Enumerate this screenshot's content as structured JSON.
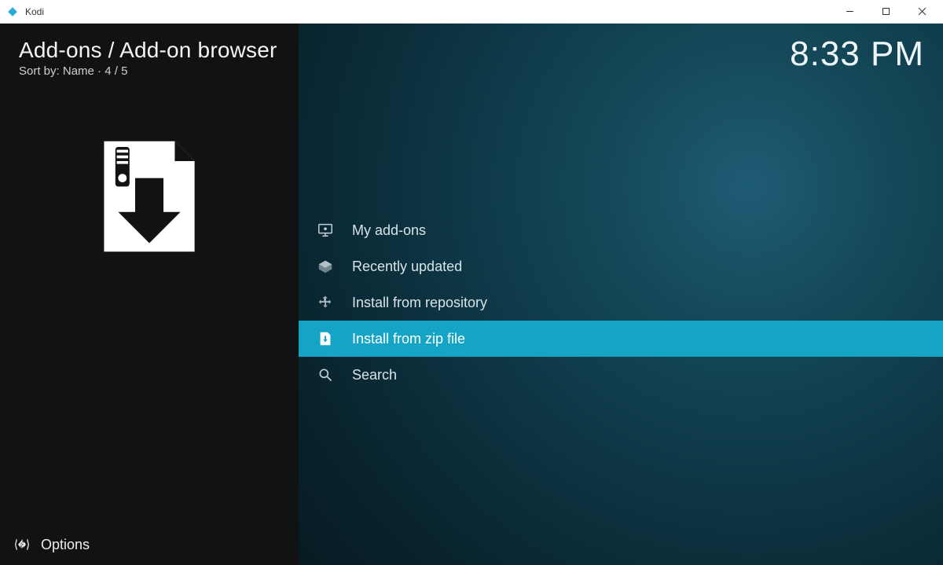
{
  "window": {
    "app_name": "Kodi"
  },
  "header": {
    "breadcrumb": "Add-ons / Add-on browser",
    "sort_label": "Sort by:",
    "sort_value": "Name",
    "position": "4 / 5"
  },
  "clock": "8:33 PM",
  "menu": {
    "items": [
      {
        "icon": "monitor-addon-icon",
        "label": "My add-ons",
        "selected": false
      },
      {
        "icon": "open-box-icon",
        "label": "Recently updated",
        "selected": false
      },
      {
        "icon": "repository-icon",
        "label": "Install from repository",
        "selected": false
      },
      {
        "icon": "zip-install-icon",
        "label": "Install from zip file",
        "selected": true
      },
      {
        "icon": "search-icon",
        "label": "Search",
        "selected": false
      }
    ]
  },
  "footer": {
    "options_label": "Options"
  }
}
